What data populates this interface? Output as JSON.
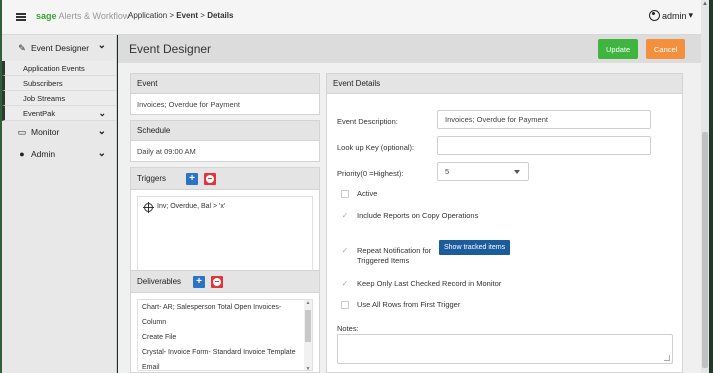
{
  "topbar": {
    "brand_logo": "sage",
    "brand_product": " Alerts & Workflow",
    "breadcrumb_prefix": "Application > ",
    "breadcrumb_event": "Event",
    "breadcrumb_sep": " > ",
    "breadcrumb_details": "Details",
    "user_label": "admin"
  },
  "sidebar": {
    "event_designer": "Event Designer",
    "sub_items": [
      "Application Events",
      "Subscribers",
      "Job Streams",
      "EventPak"
    ],
    "monitor": "Monitor",
    "admin": "Admin"
  },
  "header": {
    "title": "Event Designer",
    "update_label": "Update",
    "cancel_label": "Cancel"
  },
  "event_panel": {
    "title": "Event",
    "value": "Invoices; Overdue for Payment"
  },
  "schedule_panel": {
    "title": "Schedule",
    "value": "Daily at 09:00 AM"
  },
  "triggers_panel": {
    "title": "Triggers",
    "items": [
      "Inv; Overdue, Bal > 'x'"
    ]
  },
  "deliverables_panel": {
    "title": "Deliverables",
    "items": [
      "Chart- AR; Salesperson Total Open Invoices-",
      "Column",
      "Create File",
      "Crystal- Invoice Form- Standard Invoice Template",
      "Email"
    ]
  },
  "details": {
    "title": "Event Details",
    "description_label": "Event Description:",
    "description_value": "Invoices; Overdue for Payment",
    "lookup_label": "Look up Key (optional):",
    "lookup_value": "",
    "priority_label": "Priority(0 =Highest):",
    "priority_value": "5",
    "active_label": "Active",
    "include_reports_label": "Include Reports on Copy Operations",
    "repeat_label_1": "Repeat Notification for",
    "repeat_label_2": "Triggered Items",
    "show_tracked_label": "Show tracked items",
    "keep_last_label": "Keep Only Last Checked Record in Monitor",
    "use_all_rows_label": "Use All Rows from First Trigger",
    "notes_label": "Notes:",
    "check_glyph": "✓"
  }
}
